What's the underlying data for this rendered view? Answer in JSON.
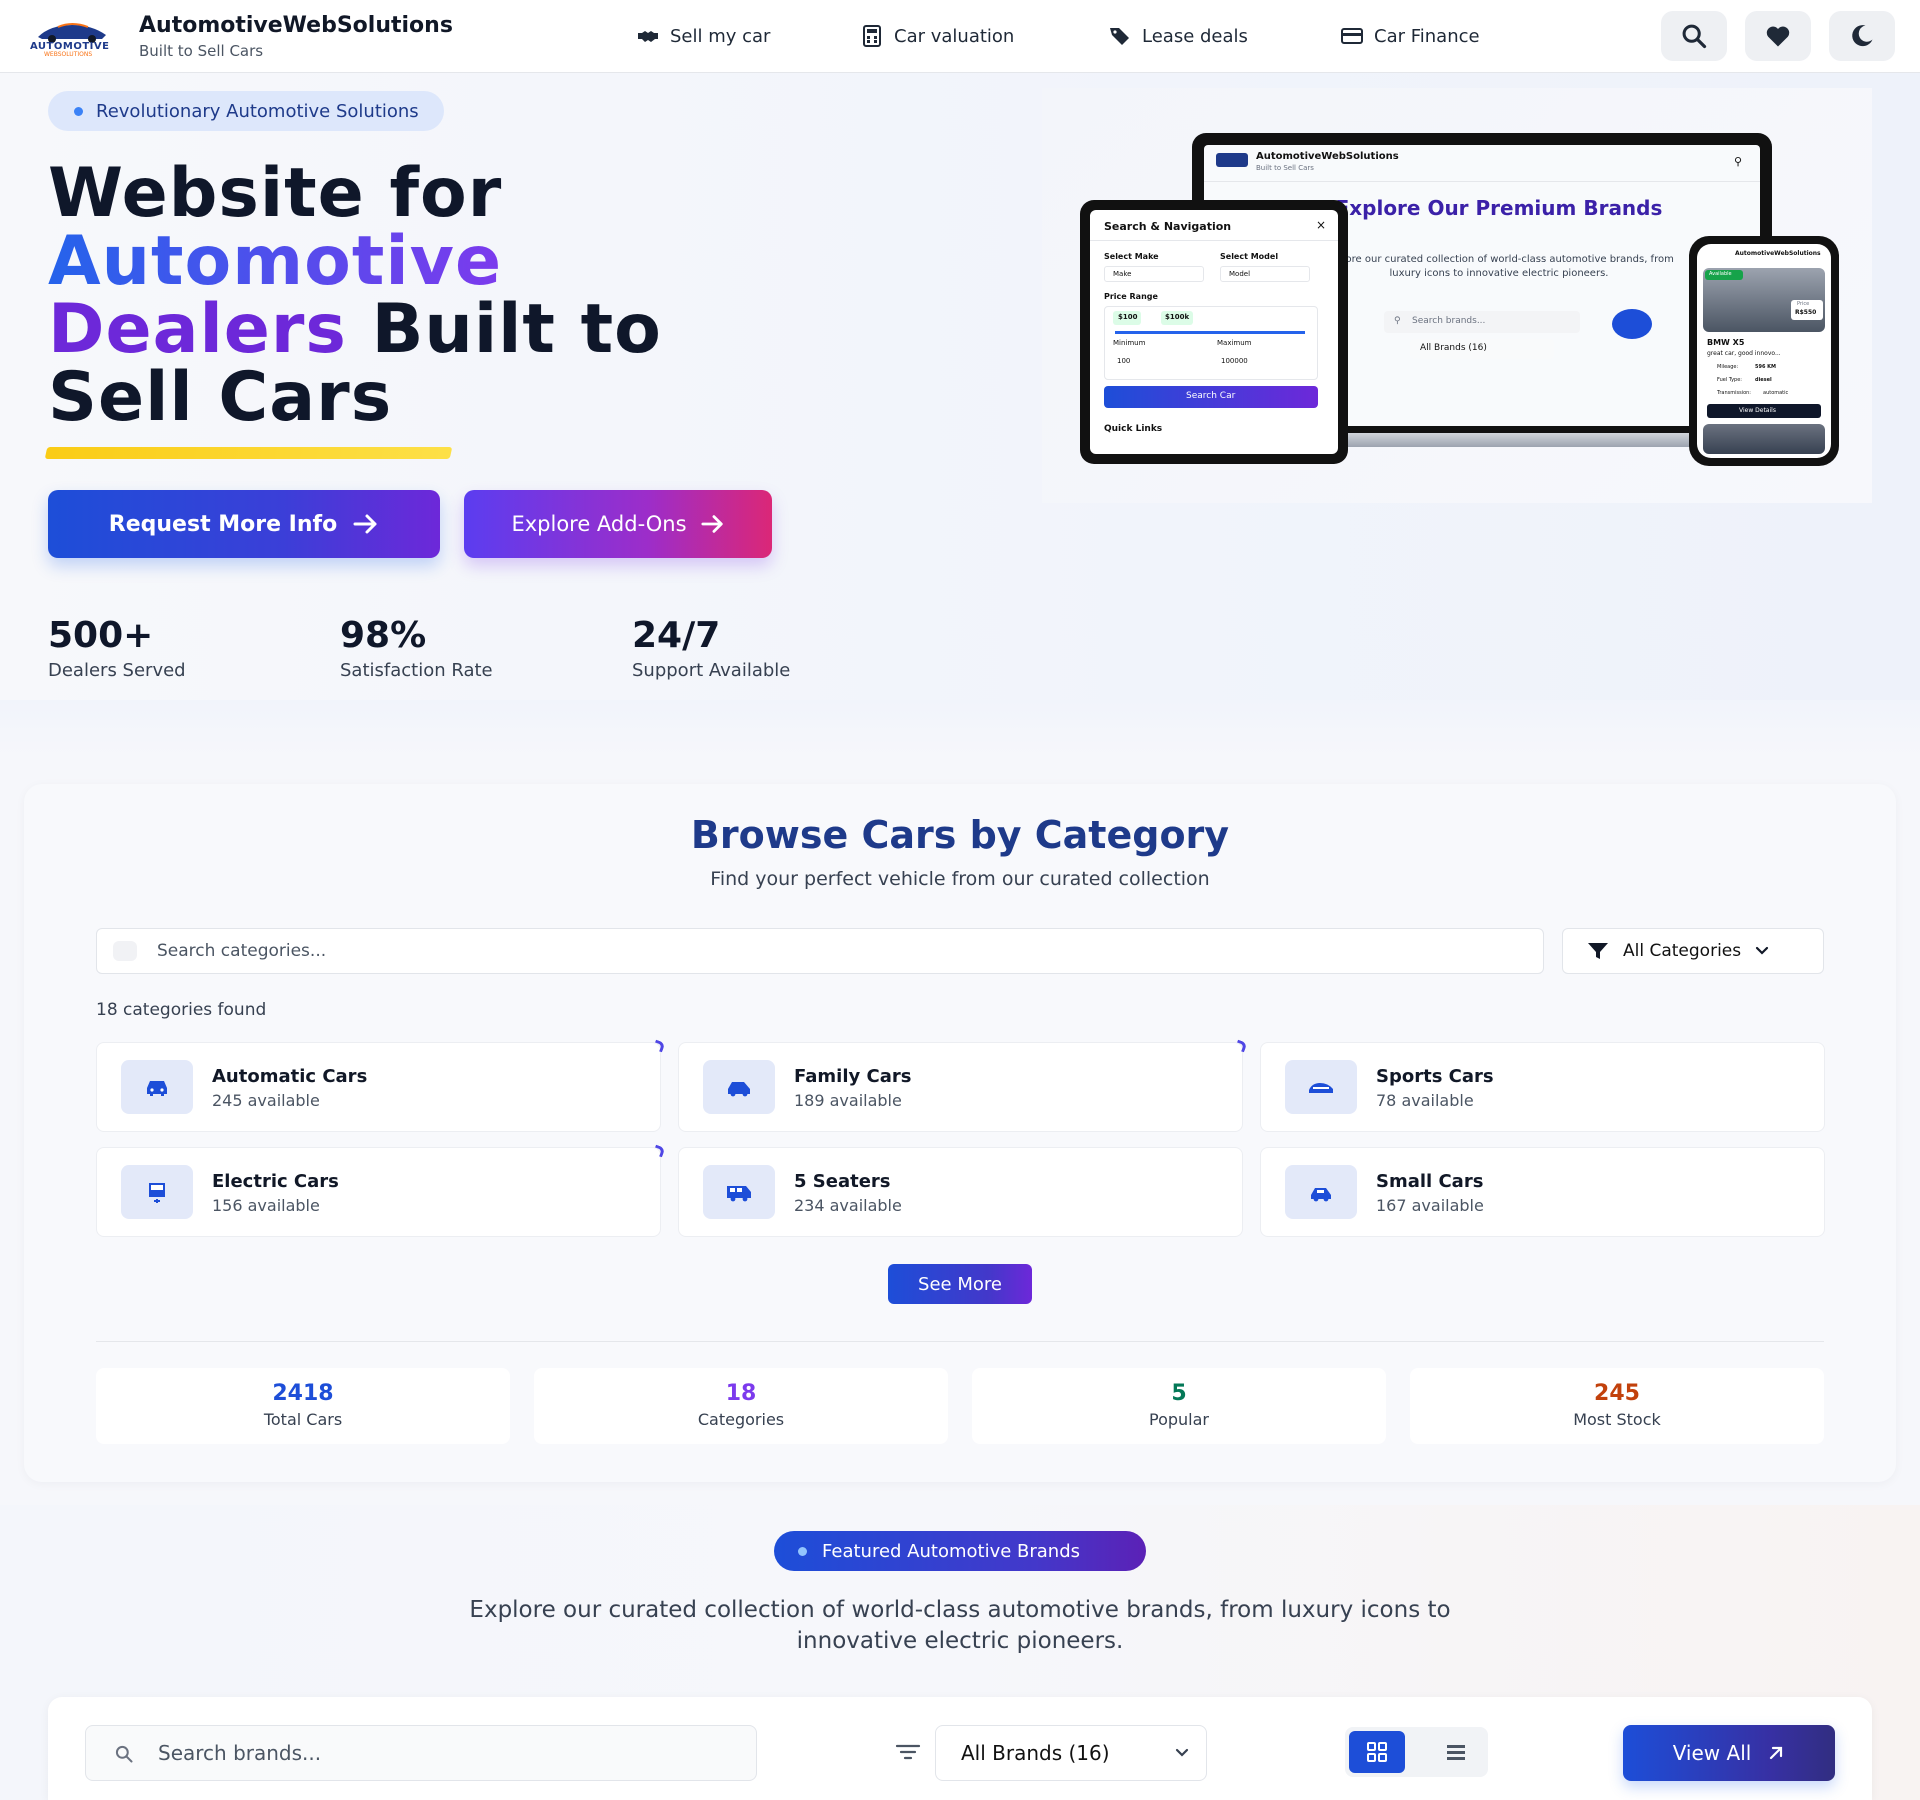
{
  "header": {
    "brand_name": "AutomotiveWebSolutions",
    "tagline": "Built to Sell Cars",
    "logo_text": "AUTOMOTIVE",
    "logo_subtext": "WEBSOLUTIONS",
    "nav": [
      {
        "label": "Sell my car",
        "icon": "handshake-icon"
      },
      {
        "label": "Car valuation",
        "icon": "calculator-icon"
      },
      {
        "label": "Lease deals",
        "icon": "tags-icon"
      },
      {
        "label": "Car Finance",
        "icon": "credit-card-icon"
      }
    ],
    "actions": [
      "search-icon",
      "heart-icon",
      "moon-icon"
    ]
  },
  "hero": {
    "badge": "Revolutionary Automotive Solutions",
    "title_line1": "Website for",
    "title_highlight1": "Automotive",
    "title_highlight2": "Dealers",
    "title_line3_rest": "Built to",
    "title_line4": "Sell Cars",
    "primary_button": "Request More Info",
    "secondary_button": "Explore Add-Ons",
    "stats": [
      {
        "value": "500+",
        "label": "Dealers Served"
      },
      {
        "value": "98%",
        "label": "Satisfaction Rate"
      },
      {
        "value": "24/7",
        "label": "Support Available"
      }
    ]
  },
  "mockup": {
    "laptop": {
      "brand": "AutomotiveWebSolutions",
      "tagline": "Built to Sell Cars",
      "heading": "Explore Our Premium Brands",
      "text": "Explore our curated collection of world-class automotive brands, from luxury icons to innovative electric pioneers.",
      "search_placeholder": "Search brands...",
      "select": "All Brands (16)"
    },
    "tablet": {
      "title": "Search & Navigation",
      "make_label": "Select Make",
      "model_label": "Select Model",
      "make_value": "Make",
      "model_value": "Model",
      "price_label": "Price Range",
      "min_tag": "$100",
      "max_tag": "$100k",
      "min_label": "Minimum",
      "max_label": "Maximum",
      "min_value": "100",
      "max_value": "100000",
      "button": "Search Car",
      "quick_links": "Quick Links"
    },
    "phone": {
      "brand": "AutomotiveWebSolutions",
      "badge": "Available",
      "price_label": "Price",
      "price": "R$550",
      "car_name": "BMW X5",
      "car_desc": "great car, good innovo...",
      "mileage_label": "Mileage:",
      "mileage": "596 KM",
      "fuel_label": "Fuel Type:",
      "fuel": "diesel",
      "transmission_label": "Transmission:",
      "transmission": "automatic",
      "button": "View Details"
    }
  },
  "categories": {
    "title": "Browse Cars by Category",
    "subtitle": "Find your perfect vehicle from our curated collection",
    "search_placeholder": "Search categories...",
    "filter_label": "All Categories",
    "found_text": "18 categories found",
    "items": [
      {
        "name": "Automatic Cars",
        "available": "245 available"
      },
      {
        "name": "Family Cars",
        "available": "189 available"
      },
      {
        "name": "Sports Cars",
        "available": "78 available"
      },
      {
        "name": "Electric Cars",
        "available": "156 available"
      },
      {
        "name": "5 Seaters",
        "available": "234 available"
      },
      {
        "name": "Small Cars",
        "available": "167 available"
      }
    ],
    "see_more": "See More",
    "stats": [
      {
        "value": "2418",
        "label": "Total Cars",
        "color": "#1d4ed8"
      },
      {
        "value": "18",
        "label": "Categories",
        "color": "#7c3aed"
      },
      {
        "value": "5",
        "label": "Popular",
        "color": "#047857"
      },
      {
        "value": "245",
        "label": "Most Stock",
        "color": "#c2410c"
      }
    ]
  },
  "brands": {
    "badge": "Featured Automotive Brands",
    "description": "Explore our curated collection of world-class automotive brands, from luxury icons to innovative electric pioneers.",
    "search_placeholder": "Search brands...",
    "select_label": "All Brands (16)",
    "view_all": "View All"
  },
  "colors": {
    "primary": "#1d4ed8",
    "accent_purple": "#7c3aed",
    "accent_pink": "#db2777",
    "highlight_yellow": "#facc15"
  }
}
